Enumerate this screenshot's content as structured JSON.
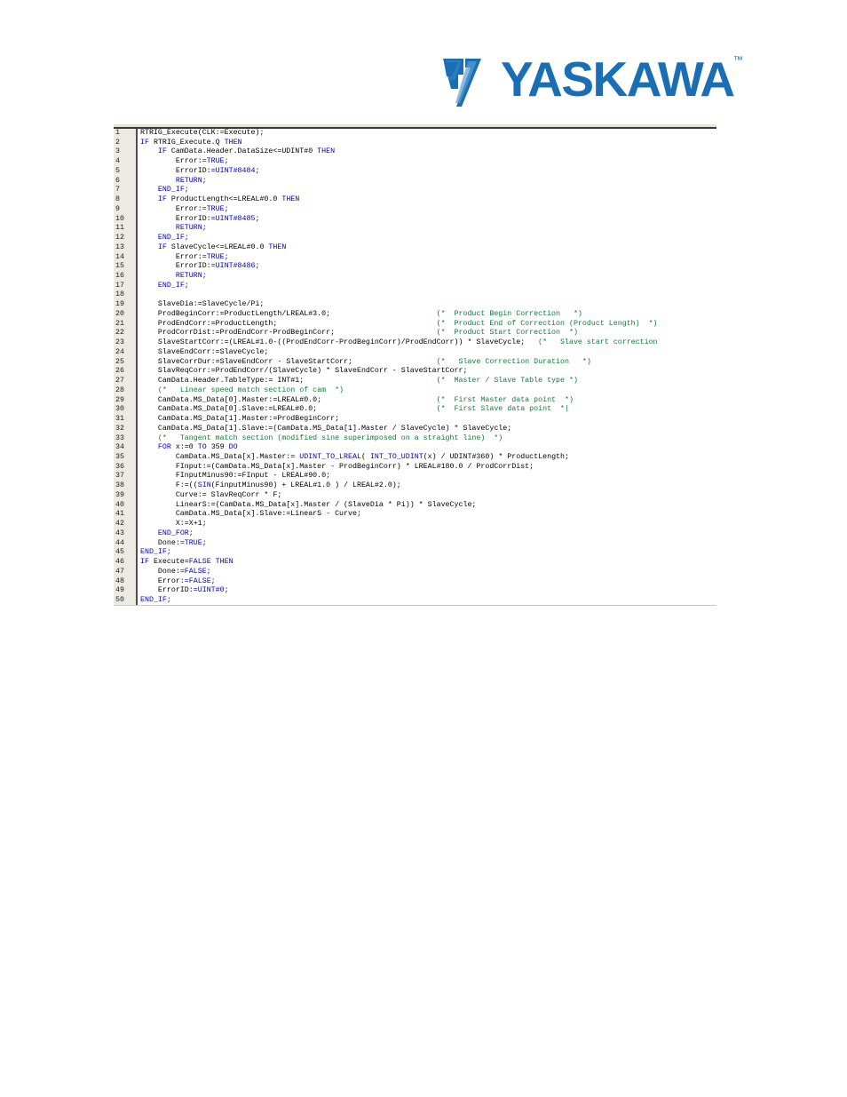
{
  "page": {
    "background": "#ffffff"
  },
  "logo": {
    "name": "yaskawa-logo",
    "wordmark": "YASKAWA",
    "trademark": "™",
    "brand_color": "#1a6fb4",
    "mark_icon": "yaskawa-v-mark-icon"
  },
  "code_editor": {
    "language": "Structured Text",
    "gutter_background": "#eceae3",
    "keyword_color": "#0000c8",
    "comment_color": "#117a39",
    "identifier_color": "#000000",
    "first_line_number": 1,
    "last_line_number": 50,
    "lines": [
      {
        "n": "1",
        "tokens": [
          {
            "t": "id",
            "s": "RTRIG_Execute(CLK:"
          },
          {
            "t": "kw",
            "s": "="
          },
          {
            "t": "id",
            "s": "Execute)"
          },
          {
            "t": "kw",
            "s": ";"
          }
        ]
      },
      {
        "n": "2",
        "tokens": [
          {
            "t": "kw",
            "s": "IF "
          },
          {
            "t": "id",
            "s": "RTRIG_Execute.Q "
          },
          {
            "t": "kw",
            "s": "THEN"
          }
        ]
      },
      {
        "n": "3",
        "tokens": [
          {
            "t": "id",
            "s": "    "
          },
          {
            "t": "kw",
            "s": "IF "
          },
          {
            "t": "id",
            "s": "CamData.Header.DataSize<=UDINT#0 "
          },
          {
            "t": "kw",
            "s": "THEN"
          }
        ]
      },
      {
        "n": "4",
        "tokens": [
          {
            "t": "id",
            "s": "        Error:"
          },
          {
            "t": "kw",
            "s": "=TRUE;"
          }
        ]
      },
      {
        "n": "5",
        "tokens": [
          {
            "t": "id",
            "s": "        ErrorID:"
          },
          {
            "t": "kw",
            "s": "=UINT#8484;"
          }
        ]
      },
      {
        "n": "6",
        "tokens": [
          {
            "t": "id",
            "s": "        "
          },
          {
            "t": "kw",
            "s": "RETURN;"
          }
        ]
      },
      {
        "n": "7",
        "tokens": [
          {
            "t": "id",
            "s": "    "
          },
          {
            "t": "kw",
            "s": "END_IF;"
          }
        ]
      },
      {
        "n": "8",
        "tokens": [
          {
            "t": "id",
            "s": "    "
          },
          {
            "t": "kw",
            "s": "IF "
          },
          {
            "t": "id",
            "s": "ProductLength<=LREAL#0.0 "
          },
          {
            "t": "kw",
            "s": "THEN"
          }
        ]
      },
      {
        "n": "9",
        "tokens": [
          {
            "t": "id",
            "s": "        Error:"
          },
          {
            "t": "kw",
            "s": "=TRUE;"
          }
        ]
      },
      {
        "n": "10",
        "tokens": [
          {
            "t": "id",
            "s": "        ErrorID:"
          },
          {
            "t": "kw",
            "s": "=UINT#8485;"
          }
        ]
      },
      {
        "n": "11",
        "tokens": [
          {
            "t": "id",
            "s": "        "
          },
          {
            "t": "kw",
            "s": "RETURN;"
          }
        ]
      },
      {
        "n": "12",
        "tokens": [
          {
            "t": "id",
            "s": "    "
          },
          {
            "t": "kw",
            "s": "END_IF;"
          }
        ]
      },
      {
        "n": "13",
        "tokens": [
          {
            "t": "id",
            "s": "    "
          },
          {
            "t": "kw",
            "s": "IF "
          },
          {
            "t": "id",
            "s": "SlaveCycle<=LREAL#0.0 "
          },
          {
            "t": "kw",
            "s": "THEN"
          }
        ]
      },
      {
        "n": "14",
        "tokens": [
          {
            "t": "id",
            "s": "        Error:"
          },
          {
            "t": "kw",
            "s": "=TRUE;"
          }
        ]
      },
      {
        "n": "15",
        "tokens": [
          {
            "t": "id",
            "s": "        ErrorID:"
          },
          {
            "t": "kw",
            "s": "=UINT#8486;"
          }
        ]
      },
      {
        "n": "16",
        "tokens": [
          {
            "t": "id",
            "s": "        "
          },
          {
            "t": "kw",
            "s": "RETURN;"
          }
        ]
      },
      {
        "n": "17",
        "tokens": [
          {
            "t": "id",
            "s": "    "
          },
          {
            "t": "kw",
            "s": "END_IF;"
          }
        ]
      },
      {
        "n": "18",
        "tokens": [
          {
            "t": "id",
            "s": ""
          }
        ]
      },
      {
        "n": "19",
        "tokens": [
          {
            "t": "id",
            "s": "    SlaveDia:=SlaveCycle/Pi;"
          }
        ]
      },
      {
        "n": "20",
        "tokens": [
          {
            "t": "id",
            "s": "    ProdBeginCorr:=ProductLength/LREAL#3.0;                        "
          },
          {
            "t": "cm",
            "s": "(*  Product Begin Correction   *)"
          }
        ]
      },
      {
        "n": "21",
        "tokens": [
          {
            "t": "id",
            "s": "    ProdEndCorr:=ProductLength;                                    "
          },
          {
            "t": "cm",
            "s": "(*  Product End of Correction (Product Length)  *)"
          }
        ]
      },
      {
        "n": "22",
        "tokens": [
          {
            "t": "id",
            "s": "    ProdCorrDist:=ProdEndCorr-ProdBeginCorr;                       "
          },
          {
            "t": "cm",
            "s": "(*  Product Start Correction  *)"
          }
        ]
      },
      {
        "n": "23",
        "tokens": [
          {
            "t": "id",
            "s": "    SlaveStartCorr:=(LREAL#1.0-((ProdEndCorr-ProdBeginCorr)/ProdEndCorr)) * SlaveCycle;   "
          },
          {
            "t": "cm",
            "s": "(*   Slave start correction"
          }
        ]
      },
      {
        "n": "24",
        "tokens": [
          {
            "t": "id",
            "s": "    SlaveEndCorr:=SlaveCycle;"
          }
        ]
      },
      {
        "n": "25",
        "tokens": [
          {
            "t": "id",
            "s": "    SlaveCorrDur:=SlaveEndCorr - SlaveStartCorr;                   "
          },
          {
            "t": "cm",
            "s": "(*   Slave Correction Duration   *)"
          }
        ]
      },
      {
        "n": "26",
        "tokens": [
          {
            "t": "id",
            "s": "    SlavReqCorr:=ProdEndCorr/(SlaveCycle) * SlaveEndCorr - SlaveStartCorr;"
          }
        ]
      },
      {
        "n": "27",
        "tokens": [
          {
            "t": "id",
            "s": "    CamData.Header.TableType:= INT#1;                              "
          },
          {
            "t": "cm",
            "s": "(*  Master / Slave Table type *)"
          }
        ]
      },
      {
        "n": "28",
        "tokens": [
          {
            "t": "id",
            "s": "    "
          },
          {
            "t": "cm",
            "s": "(*   Linear speed match section of cam  *)"
          }
        ]
      },
      {
        "n": "29",
        "tokens": [
          {
            "t": "id",
            "s": "    CamData.MS_Data[0].Master:=LREAL#0.0;                          "
          },
          {
            "t": "cm",
            "s": "(*  First Master data point  *)"
          }
        ]
      },
      {
        "n": "30",
        "tokens": [
          {
            "t": "id",
            "s": "    CamData.MS_Data[0].Slave:=LREAL#0.0;                           "
          },
          {
            "t": "cm",
            "s": "(*  First Slave data point  *|"
          }
        ]
      },
      {
        "n": "31",
        "tokens": [
          {
            "t": "id",
            "s": "    CamData.MS_Data[1].Master:=ProdBeginCorr;"
          }
        ]
      },
      {
        "n": "32",
        "tokens": [
          {
            "t": "id",
            "s": "    CamData.MS_Data[1].Slave:=(CamData.MS_Data[1].Master / SlaveCycle) * SlaveCycle;"
          }
        ]
      },
      {
        "n": "33",
        "tokens": [
          {
            "t": "id",
            "s": "    "
          },
          {
            "t": "cm",
            "s": "(*   Tangent match section (modified sine superimposed on a straight line)  *)"
          }
        ]
      },
      {
        "n": "34",
        "tokens": [
          {
            "t": "id",
            "s": "    "
          },
          {
            "t": "kw",
            "s": "FOR "
          },
          {
            "t": "id",
            "s": "x:=0 "
          },
          {
            "t": "kw",
            "s": "TO "
          },
          {
            "t": "id",
            "s": "359 "
          },
          {
            "t": "kw",
            "s": "DO"
          }
        ]
      },
      {
        "n": "35",
        "tokens": [
          {
            "t": "id",
            "s": "        CamData.MS_Data[x].Master:= "
          },
          {
            "t": "kw",
            "s": "UDINT_TO_LREAL"
          },
          {
            "t": "id",
            "s": "( "
          },
          {
            "t": "kw",
            "s": "INT_TO_UDINT"
          },
          {
            "t": "id",
            "s": "(x) / UDINT#360) * ProductLength;"
          }
        ]
      },
      {
        "n": "36",
        "tokens": [
          {
            "t": "id",
            "s": "        FInput:=(CamData.MS_Data[x].Master - ProdBeginCorr) * LREAL#180.0 / ProdCorrDist;"
          }
        ]
      },
      {
        "n": "37",
        "tokens": [
          {
            "t": "id",
            "s": "        FInputMinus90:=FInput - LREAL#90.0;"
          }
        ]
      },
      {
        "n": "38",
        "tokens": [
          {
            "t": "id",
            "s": "        F:=(("
          },
          {
            "t": "kw",
            "s": "SIN"
          },
          {
            "t": "id",
            "s": "(FinputMinus90) + LREAL#1.0 ) / LREAL#2.0);"
          }
        ]
      },
      {
        "n": "39",
        "tokens": [
          {
            "t": "id",
            "s": "        Curve:= SlavReqCorr * F;"
          }
        ]
      },
      {
        "n": "40",
        "tokens": [
          {
            "t": "id",
            "s": "        LinearS:=(CamData.MS_Data[x].Master / (SlaveDia * Pi)) * SlaveCycle;"
          }
        ]
      },
      {
        "n": "41",
        "tokens": [
          {
            "t": "id",
            "s": "        CamData.MS_Data[x].Slave:=LinearS - Curve;"
          }
        ]
      },
      {
        "n": "42",
        "tokens": [
          {
            "t": "id",
            "s": "        X:=X+1;"
          }
        ]
      },
      {
        "n": "43",
        "tokens": [
          {
            "t": "id",
            "s": "    "
          },
          {
            "t": "kw",
            "s": "END_FOR;"
          }
        ]
      },
      {
        "n": "44",
        "tokens": [
          {
            "t": "id",
            "s": "    Done:"
          },
          {
            "t": "kw",
            "s": "=TRUE;"
          }
        ]
      },
      {
        "n": "45",
        "tokens": [
          {
            "t": "kw",
            "s": "END_IF;"
          }
        ]
      },
      {
        "n": "46",
        "tokens": [
          {
            "t": "kw",
            "s": "IF "
          },
          {
            "t": "id",
            "s": "Execute="
          },
          {
            "t": "kw",
            "s": "FALSE THEN"
          }
        ]
      },
      {
        "n": "47",
        "tokens": [
          {
            "t": "id",
            "s": "    Done:"
          },
          {
            "t": "kw",
            "s": "=FALSE;"
          }
        ]
      },
      {
        "n": "48",
        "tokens": [
          {
            "t": "id",
            "s": "    Error:"
          },
          {
            "t": "kw",
            "s": "=FALSE;"
          }
        ]
      },
      {
        "n": "49",
        "tokens": [
          {
            "t": "id",
            "s": "    ErrorID:"
          },
          {
            "t": "kw",
            "s": "=UINT#0;"
          }
        ]
      },
      {
        "n": "50",
        "tokens": [
          {
            "t": "kw",
            "s": "END_IF;"
          }
        ]
      }
    ]
  }
}
